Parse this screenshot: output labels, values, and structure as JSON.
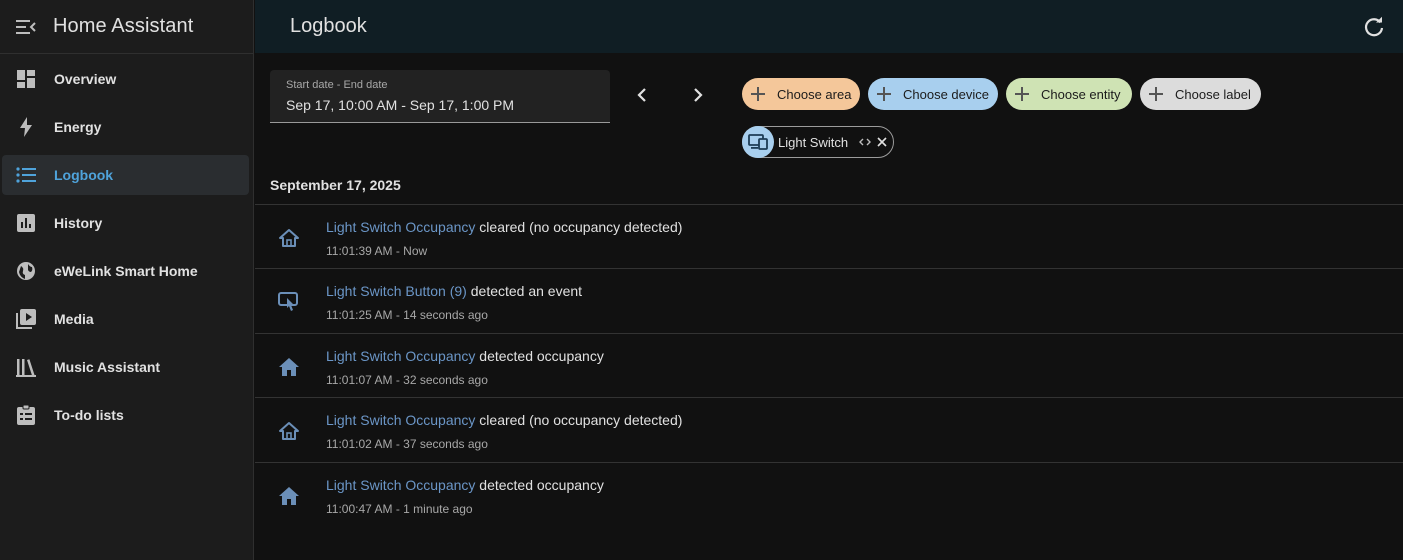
{
  "sidebar": {
    "title": "Home Assistant",
    "items": [
      {
        "label": "Overview",
        "icon": "view-dashboard-icon"
      },
      {
        "label": "Energy",
        "icon": "lightning-bolt-icon"
      },
      {
        "label": "Logbook",
        "icon": "format-list-bulleted-icon",
        "active": true
      },
      {
        "label": "History",
        "icon": "chart-box-icon"
      },
      {
        "label": "eWeLink Smart Home",
        "icon": "web-icon"
      },
      {
        "label": "Media",
        "icon": "play-box-multiple-icon"
      },
      {
        "label": "Music Assistant",
        "icon": "library-icon"
      },
      {
        "label": "To-do lists",
        "icon": "clipboard-list-icon"
      }
    ]
  },
  "header": {
    "title": "Logbook"
  },
  "filters": {
    "date_label": "Start date - End date",
    "date_value": "Sep 17, 10:00 AM - Sep 17, 1:00 PM",
    "chips": [
      {
        "label": "Choose area",
        "color": "#f4c79a"
      },
      {
        "label": "Choose device",
        "color": "#a8cfee"
      },
      {
        "label": "Choose entity",
        "color": "#cfe3b4"
      },
      {
        "label": "Choose label",
        "color": "#dcdcdc"
      }
    ],
    "selected": {
      "label": "Light Switch",
      "icon": "devices-icon"
    }
  },
  "date_heading": "September 17, 2025",
  "entries": [
    {
      "name": "Light Switch Occupancy",
      "message": "cleared (no occupancy detected)",
      "time": "11:01:39 AM - Now",
      "icon": "home-outline-icon"
    },
    {
      "name": "Light Switch Button (9)",
      "message": "detected an event",
      "time": "11:01:25 AM - 14 seconds ago",
      "icon": "gesture-tap-button-icon"
    },
    {
      "name": "Light Switch Occupancy",
      "message": "detected occupancy",
      "time": "11:01:07 AM - 32 seconds ago",
      "icon": "home-icon"
    },
    {
      "name": "Light Switch Occupancy",
      "message": "cleared (no occupancy detected)",
      "time": "11:01:02 AM - 37 seconds ago",
      "icon": "home-outline-icon"
    },
    {
      "name": "Light Switch Occupancy",
      "message": "detected occupancy",
      "time": "11:00:47 AM - 1 minute ago",
      "icon": "home-icon"
    }
  ],
  "colors": {
    "accent": "#4fa3db",
    "entity_link": "#6b96c7",
    "icon": "#6b8fb8"
  }
}
